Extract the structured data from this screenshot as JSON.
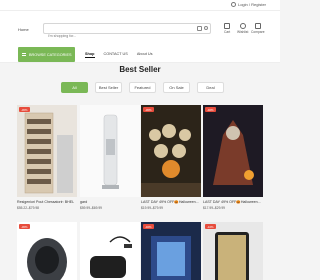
{
  "topbar": {
    "login_label": "Login / Register"
  },
  "header": {
    "home_label": "Home",
    "search_placeholder": "I'm shopping for...",
    "icons": [
      {
        "name": "cart-icon",
        "label": "Cart"
      },
      {
        "name": "wishlist-icon",
        "label": "Wishlist"
      },
      {
        "name": "compare-icon",
        "label": "Compare"
      }
    ]
  },
  "nav": {
    "browse_label": "BROWSE CATEGORIES",
    "links": [
      "Shop",
      "CONTACT US",
      "About Us"
    ]
  },
  "section": {
    "title": "Best Seller",
    "tabs": [
      "All",
      "Best Seller",
      "Featured",
      "On Sale",
      "Deal"
    ]
  },
  "products": [
    {
      "badge": "-30%",
      "name": "Resigeniori Pout Chessatorir: BHEL",
      "price": "$55.22–$79.98"
    },
    {
      "badge": "",
      "name": "gard",
      "price": "$59.99–$69.99"
    },
    {
      "badge": "-30%",
      "name": "LAST DAY 49% OFF🎃Halloween...",
      "price": "$19.99–$79.99"
    },
    {
      "badge": "-40%",
      "name": "LAST DAY 49% OFF🎃Halloween...",
      "price": "$17.99–$29.99"
    }
  ],
  "products_row2": [
    {
      "badge": "-30%"
    },
    {
      "badge": ""
    },
    {
      "badge": "-40%"
    },
    {
      "badge": "-10%"
    }
  ],
  "colors": {
    "accent": "#7ab856",
    "sale": "#e74c3c"
  }
}
